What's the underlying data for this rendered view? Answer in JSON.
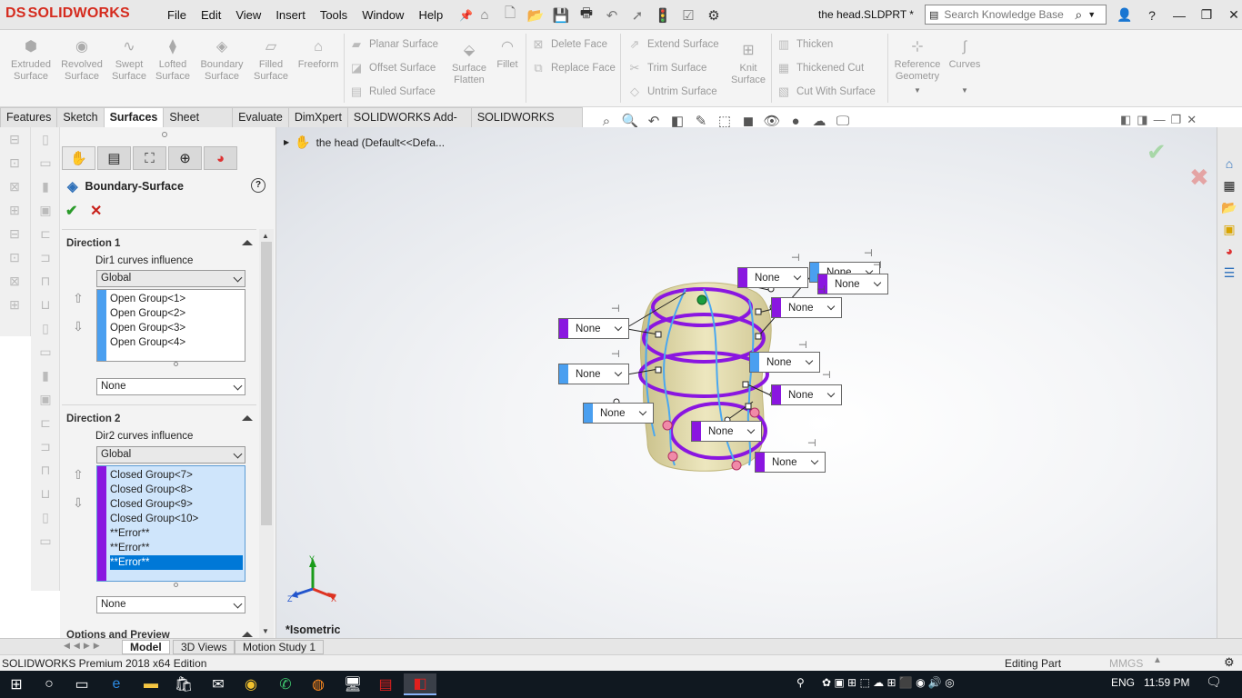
{
  "app": {
    "brand": "SOLIDWORKS",
    "brand_prefix": "DS",
    "doc_title": "the head.SLDPRT *"
  },
  "menu": [
    "File",
    "Edit",
    "View",
    "Insert",
    "Tools",
    "Window",
    "Help"
  ],
  "search": {
    "placeholder": "Search Knowledge Base"
  },
  "ribbon": {
    "big_buttons": [
      {
        "label": "Extruded Surface",
        "icon": "extruded-surface-icon"
      },
      {
        "label": "Revolved Surface",
        "icon": "revolved-surface-icon"
      },
      {
        "label": "Swept Surface",
        "icon": "swept-surface-icon"
      },
      {
        "label": "Lofted Surface",
        "icon": "lofted-surface-icon"
      },
      {
        "label": "Boundary Surface",
        "icon": "boundary-surface-icon"
      },
      {
        "label": "Filled Surface",
        "icon": "filled-surface-icon"
      },
      {
        "label": "Freeform",
        "icon": "freeform-icon"
      }
    ],
    "col1": [
      "Planar Surface",
      "Offset Surface",
      "Ruled Surface"
    ],
    "surface_flatten": "Surface Flatten",
    "fillet": "Fillet",
    "col2": [
      "Delete Face",
      "Replace Face"
    ],
    "col3": [
      "Extend Surface",
      "Trim Surface",
      "Untrim Surface"
    ],
    "knit_surface": "Knit Surface",
    "col4": [
      "Thicken",
      "Thickened Cut",
      "Cut With Surface"
    ],
    "reference_geometry": "Reference Geometry",
    "curves": "Curves"
  },
  "tabs": [
    "Features",
    "Sketch",
    "Surfaces",
    "Sheet Metal",
    "Evaluate",
    "DimXpert",
    "SOLIDWORKS Add-Ins",
    "SOLIDWORKS MBD"
  ],
  "active_tab": "Surfaces",
  "property_manager": {
    "title": "Boundary-Surface",
    "direction1": {
      "heading": "Direction 1",
      "influence_label": "Dir1 curves influence",
      "influence_value": "Global",
      "curves": [
        "Open Group<1>",
        "Open Group<2>",
        "Open Group<3>",
        "Open Group<4>"
      ],
      "tangency": "None",
      "color": "#4a9ff0"
    },
    "direction2": {
      "heading": "Direction 2",
      "influence_label": "Dir2 curves influence",
      "influence_value": "Global",
      "curves": [
        "Closed Group<7>",
        "Closed Group<8>",
        "Closed Group<9>",
        "Closed Group<10>",
        "**Error**",
        "**Error**",
        "**Error**"
      ],
      "selected_index": 6,
      "tangency": "None",
      "color": "#8a16e0"
    },
    "options_heading": "Options and Preview"
  },
  "graphics": {
    "tree_item": "the head  (Default<<Defa...",
    "view_name": "*Isometric",
    "callout_label": "None",
    "triad": {
      "x": "X",
      "y": "Y",
      "z": "Z"
    }
  },
  "bottom_tabs": [
    "Model",
    "3D Views",
    "Motion Study 1"
  ],
  "active_bottom_tab": "Model",
  "status": {
    "left": "SOLIDWORKS Premium 2018 x64 Edition",
    "mode": "Editing Part",
    "units": "MMGS"
  },
  "taskbar": {
    "language": "ENG",
    "time": "11:59 PM"
  }
}
